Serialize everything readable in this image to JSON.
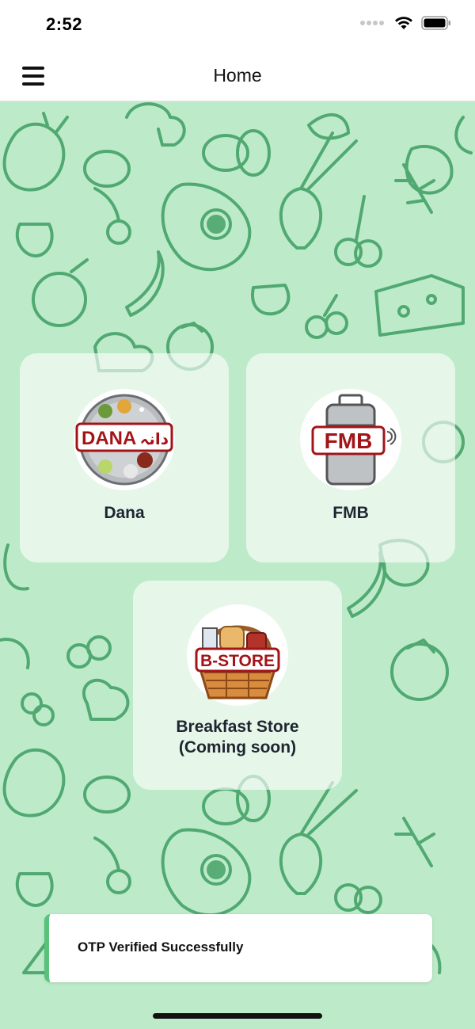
{
  "status_bar": {
    "time": "2:52"
  },
  "header": {
    "title": "Home"
  },
  "cards": [
    {
      "label": "Dana",
      "logo_text": "DANA",
      "logo_urdu": "دانہ"
    },
    {
      "label": "FMB",
      "logo_text": "FMB"
    },
    {
      "label": "Breakfast Store\n(Coming soon)",
      "logo_text": "B-STORE"
    }
  ],
  "toast": {
    "message": "OTP Verified Successfully"
  },
  "colors": {
    "background": "#bdebc9",
    "pattern": "#3f9e63",
    "accent": "#59c27a",
    "logo_red": "#a31418"
  },
  "icons": [
    "menu-icon",
    "wifi-icon",
    "battery-icon",
    "signal-icon"
  ]
}
